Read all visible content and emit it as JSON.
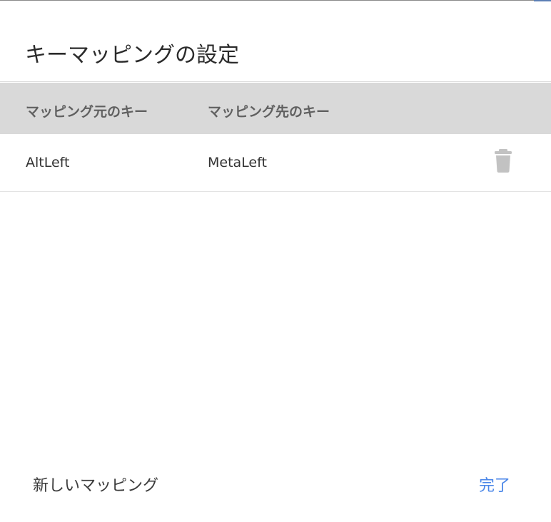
{
  "dialog": {
    "title": "キーマッピングの設定"
  },
  "table": {
    "columns": [
      "マッピング元のキー",
      "マッピング先のキー"
    ],
    "rows": [
      {
        "from": "AltLeft",
        "to": "MetaLeft",
        "action_icon": "trash-icon"
      }
    ]
  },
  "footer": {
    "new_mapping_label": "新しいマッピング",
    "done_label": "完了"
  },
  "colors": {
    "header_bg": "#d9d9d9",
    "accent": "#4a86e8",
    "icon": "#c2c2c2"
  }
}
